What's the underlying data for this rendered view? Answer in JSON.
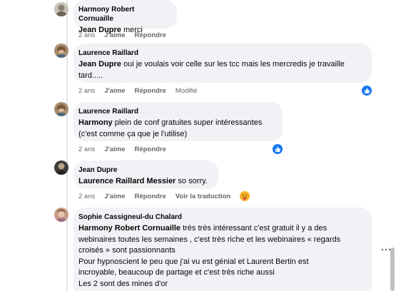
{
  "comments": [
    {
      "author": "Harmony Robert Cornuaille",
      "mention": "Jean Dupre",
      "text": " merci",
      "time": "2 ans",
      "like_label": "J'aime",
      "reply_label": "Répondre"
    },
    {
      "author": "Laurence Raillard",
      "mention": "Jean Dupre",
      "text_line1": " oui je voulais voir celle sur les tcc mais les mercredis je travaille",
      "text_line2": "tard.....",
      "time": "2 ans",
      "like_label": "J'aime",
      "reply_label": "Répondre",
      "edited_label": "Modifié"
    },
    {
      "author": "Laurence Raillard",
      "mention": "Harmony",
      "text_line1": " plein de conf gratuites super intéressantes",
      "text_line2": "(c'est comme ça que je l'utilise)",
      "time": "2 ans",
      "like_label": "J'aime",
      "reply_label": "Répondre"
    },
    {
      "author": "Jean Dupre",
      "mention": "Laurence Raillard Messier",
      "text": " so sorry.",
      "time": "2 ans",
      "like_label": "J'aime",
      "reply_label": "Répondre",
      "translate_label": "Voir la traduction"
    },
    {
      "author": "Sophie Cassigneul-du Chalard",
      "mention": "Harmony Robert Cornuaille",
      "text_line1": " très très intéressant c'est gratuit il y a des",
      "text_line2": "webinaires toutes les semaines , c'est très riche et les webinaires « regards",
      "text_line3": "croisés » sont passionnants",
      "text_line4": "Pour hypnoscient le peu que j'ai vu est génial et Laurent Bertin est",
      "text_line5": "incroyable, beaucoup de partage et c'est très riche aussi",
      "text_line6": "Les 2 sont des mines d'or"
    }
  ],
  "colors": {
    "bubble": "#f0f2f5",
    "like_blue": "#1877f2",
    "meta_gray": "#65676b"
  },
  "icons": [
    "avatar-harmony",
    "avatar-laurence",
    "avatar-jean",
    "avatar-sophie",
    "thumbs-up-icon",
    "care-emoji-icon",
    "more-options-icon"
  ]
}
